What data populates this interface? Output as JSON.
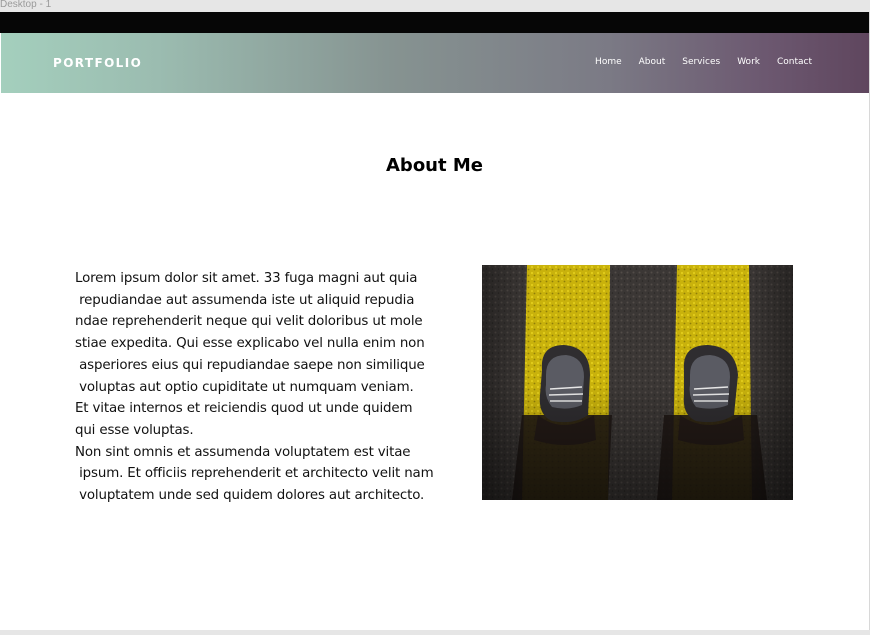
{
  "canvas": {
    "frame_label": "Desktop - 1"
  },
  "navbar": {
    "brand": "PORTFOLIO",
    "links": [
      "Home",
      "About",
      "Services",
      "Work",
      "Contact"
    ]
  },
  "about": {
    "title": "About Me",
    "paragraph_lines": [
      "Lorem ipsum dolor sit amet. 33 fuga magni aut quia",
      " repudiandae aut assumenda iste ut aliquid repudia",
      "ndae reprehenderit neque qui velit doloribus ut mole",
      "stiae expedita. Qui esse explicabo vel nulla enim non",
      " asperiores eius qui repudiandae saepe non similique",
      " voluptas aut optio cupiditate ut numquam veniam.",
      "Et vitae internos et reiciendis quod ut unde quidem",
      "qui esse voluptas.",
      "Non sint omnis et assumenda voluptatem est vitae",
      " ipsum. Et officiis reprehenderit et architecto velit nam",
      " voluptatem unde sed quidem dolores aut architecto."
    ],
    "photo": {
      "subject": "feet-on-yellow-road-stripes-photo"
    }
  },
  "colors": {
    "top_bar": "#060606",
    "nav_gradient_start": "#a4cfbd",
    "nav_gradient_end": "#5f465e",
    "heading": "#000000",
    "body_text": "#111111"
  }
}
